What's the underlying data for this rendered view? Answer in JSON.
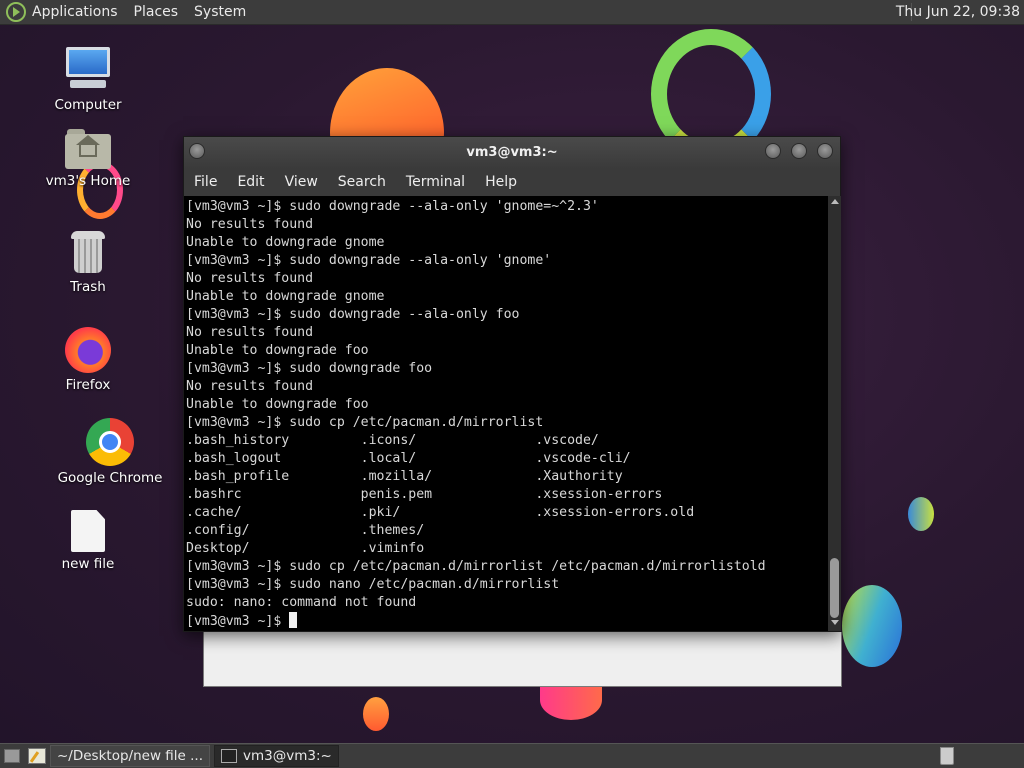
{
  "top_panel": {
    "menus": [
      "Applications",
      "Places",
      "System"
    ],
    "clock": "Thu Jun 22, 09:38"
  },
  "desktop": {
    "icons": [
      {
        "label": "Computer",
        "icon": "computer-icon"
      },
      {
        "label": "vm3's Home",
        "icon": "home-folder-icon"
      },
      {
        "label": "Trash",
        "icon": "trash-icon"
      },
      {
        "label": "Firefox",
        "icon": "firefox-icon"
      },
      {
        "label": "Google Chrome",
        "icon": "chrome-icon"
      },
      {
        "label": "new file",
        "icon": "file-icon"
      }
    ]
  },
  "terminal": {
    "title": "vm3@vm3:~",
    "menu": [
      "File",
      "Edit",
      "View",
      "Search",
      "Terminal",
      "Help"
    ],
    "lines": [
      "[vm3@vm3 ~]$ sudo downgrade --ala-only 'gnome=~^2.3'",
      "No results found",
      "Unable to downgrade gnome",
      "[vm3@vm3 ~]$ sudo downgrade --ala-only 'gnome'",
      "No results found",
      "Unable to downgrade gnome",
      "[vm3@vm3 ~]$ sudo downgrade --ala-only foo",
      "No results found",
      "Unable to downgrade foo",
      "[vm3@vm3 ~]$ sudo downgrade foo",
      "No results found",
      "Unable to downgrade foo",
      "[vm3@vm3 ~]$ sudo cp /etc/pacman.d/mirrorlist",
      ".bash_history         .icons/               .vscode/",
      ".bash_logout          .local/               .vscode-cli/",
      ".bash_profile         .mozilla/             .Xauthority",
      ".bashrc               penis.pem             .xsession-errors",
      ".cache/               .pki/                 .xsession-errors.old",
      ".config/              .themes/",
      "Desktop/              .viminfo",
      "[vm3@vm3 ~]$ sudo cp /etc/pacman.d/mirrorlist /etc/pacman.d/mirrorlistold",
      "[vm3@vm3 ~]$ sudo nano /etc/pacman.d/mirrorlist",
      "sudo: nano: command not found"
    ],
    "prompt": "[vm3@vm3 ~]$ "
  },
  "taskbar": {
    "tasks": [
      {
        "label": "~/Desktop/new file ...",
        "icon": "text-editor-icon",
        "active": false
      },
      {
        "label": "vm3@vm3:~",
        "icon": "terminal-icon",
        "active": true
      }
    ]
  },
  "colors": {
    "panel_bg": "#3c3c3c",
    "terminal_bg": "#000000",
    "terminal_fg": "#d8d8d8"
  }
}
